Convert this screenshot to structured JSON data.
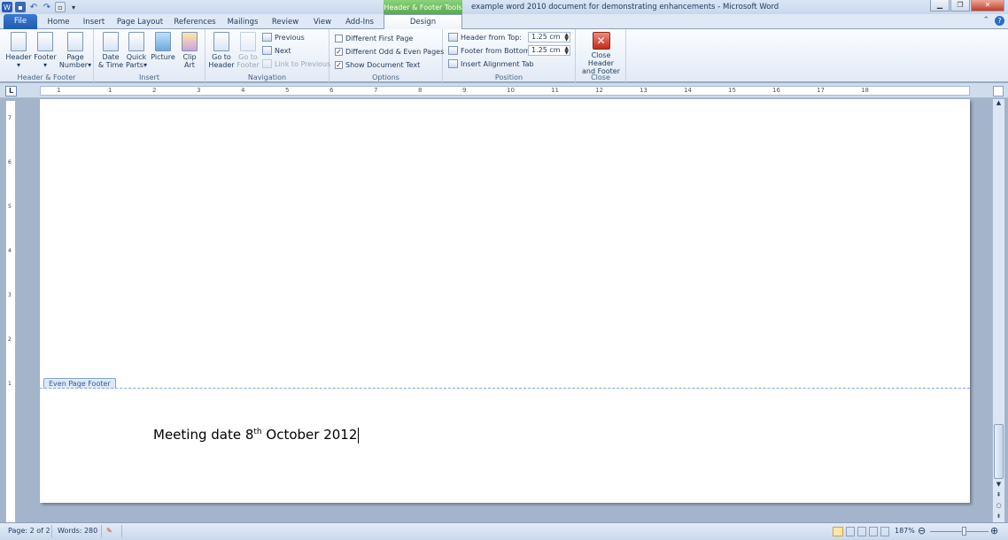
{
  "titlebar": {
    "context_tool_title": "Header & Footer Tools",
    "window_title": "example word 2010 document for demonstrating enhancements - Microsoft Word",
    "qat_icons": [
      "word-logo-icon",
      "save-icon",
      "undo-icon",
      "redo-icon",
      "new-document-icon",
      "customize-qat-icon"
    ],
    "window_buttons": [
      "minimize",
      "restore",
      "close"
    ]
  },
  "tabs": {
    "file": "File",
    "home": "Home",
    "insert": "Insert",
    "page_layout": "Page Layout",
    "references": "References",
    "mailings": "Mailings",
    "review": "Review",
    "view": "View",
    "addins": "Add-Ins",
    "design": "Design"
  },
  "ribbon": {
    "hf_group": {
      "label": "Header & Footer",
      "header": "Header",
      "footer": "Footer",
      "page_number_1": "Page",
      "page_number_2": "Number"
    },
    "insert_group": {
      "label": "Insert",
      "date_1": "Date",
      "date_2": "& Time",
      "quick_1": "Quick",
      "quick_2": "Parts",
      "picture": "Picture",
      "clip_1": "Clip",
      "clip_2": "Art"
    },
    "nav_group": {
      "label": "Navigation",
      "goto_header_1": "Go to",
      "goto_header_2": "Header",
      "goto_footer_1": "Go to",
      "goto_footer_2": "Footer",
      "previous": "Previous",
      "next": "Next",
      "link_previous": "Link to Previous"
    },
    "options_group": {
      "label": "Options",
      "diff_first": "Different First Page",
      "diff_odd_even": "Different Odd & Even Pages",
      "show_doc_text": "Show Document Text",
      "diff_first_checked": false,
      "diff_odd_even_checked": true,
      "show_doc_text_checked": true
    },
    "position_group": {
      "label": "Position",
      "header_from_top": "Header from Top:",
      "header_from_top_value": "1.25 cm",
      "footer_from_bottom": "Footer from Bottom:",
      "footer_from_bottom_value": "1.25 cm",
      "insert_alignment_tab": "Insert Alignment Tab"
    },
    "close_group": {
      "label": "Close",
      "close_1": "Close Header",
      "close_2": "and Footer"
    }
  },
  "ruler": {
    "h_numbers": [
      "1",
      "1",
      "2",
      "3",
      "4",
      "5",
      "6",
      "7",
      "8",
      "9",
      "10",
      "11",
      "12",
      "13",
      "14",
      "15",
      "16",
      "17",
      "18"
    ],
    "v_numbers": [
      "7",
      "6",
      "5",
      "4",
      "3",
      "2",
      "1"
    ]
  },
  "document": {
    "footer_tag": "Even Page Footer",
    "footer_text_a": "Meeting date 8",
    "footer_text_sup": "th",
    "footer_text_b": " October 2012"
  },
  "statusbar": {
    "page": "Page: 2 of 2",
    "words": "Words: 280",
    "zoom": "187%"
  }
}
